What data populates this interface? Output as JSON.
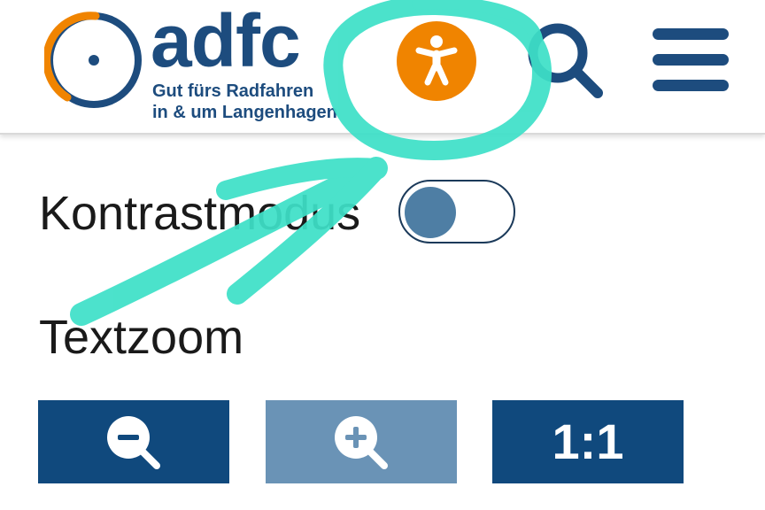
{
  "header": {
    "logo": {
      "wordmark": "adfc",
      "tagline_line1": "Gut fürs Radfahren",
      "tagline_line2": "in & um Langenhagen"
    },
    "accessibility_button": {
      "icon": "accessibility-person-icon",
      "color": "#f08400"
    },
    "search_button": {
      "icon": "search-icon",
      "color": "#1d4c7e"
    },
    "menu_button": {
      "icon": "hamburger-menu-icon",
      "color": "#1d4c7e"
    }
  },
  "accessibility_panel": {
    "contrast": {
      "label": "Kontrastmodus",
      "enabled": false
    },
    "textzoom": {
      "label": "Textzoom",
      "buttons": [
        {
          "icon": "zoom-out-icon",
          "text": ""
        },
        {
          "icon": "zoom-in-icon",
          "text": ""
        },
        {
          "icon": "",
          "text": "1:1"
        }
      ]
    }
  },
  "colors": {
    "brand_blue": "#1d4c7e",
    "brand_orange": "#f08400",
    "button_blue": "#10497d",
    "button_blue_light": "#6a93b6",
    "annotation_teal": "#3ee0c8"
  }
}
